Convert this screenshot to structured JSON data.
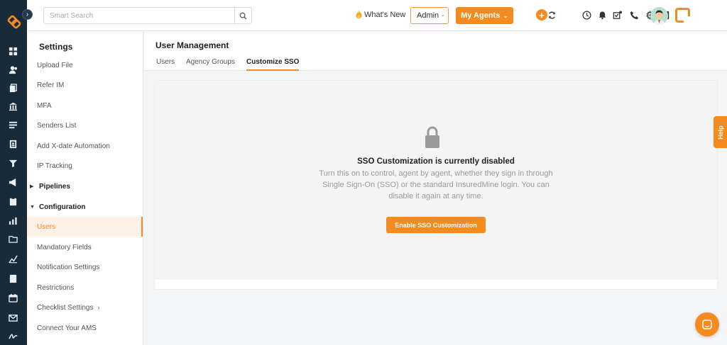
{
  "search": {
    "placeholder": "Smart Search"
  },
  "topbar": {
    "whats_new": "What's New",
    "role": "Admin",
    "my_agents": "My Agents",
    "plus": "+"
  },
  "settings": {
    "title": "Settings",
    "items": [
      {
        "label": "Upload File"
      },
      {
        "label": "Refer IM"
      },
      {
        "label": "MFA"
      },
      {
        "label": "Senders List"
      },
      {
        "label": "Add X-date Automation"
      },
      {
        "label": "IP Tracking"
      },
      {
        "label": "Pipelines"
      },
      {
        "label": "Configuration"
      },
      {
        "label": "Users"
      },
      {
        "label": "Mandatory Fields"
      },
      {
        "label": "Notification Settings"
      },
      {
        "label": "Restrictions"
      },
      {
        "label": "Checklist Settings"
      },
      {
        "label": "Connect Your AMS"
      }
    ]
  },
  "main": {
    "title": "User Management",
    "tabs": [
      {
        "label": "Users"
      },
      {
        "label": "Agency Groups"
      },
      {
        "label": "Customize SSO"
      }
    ],
    "active_tab": "Customize SSO"
  },
  "sso": {
    "title": "SSO Customization is currently disabled",
    "description": "Turn this on to control, agent by agent, whether they sign in through Single Sign-On (SSO) or the standard InsuredMine login. You can disable it again at any time.",
    "button": "Enable SSO Customization"
  },
  "help": {
    "label": "Help"
  },
  "colors": {
    "accent": "#f58a1f",
    "rail": "#172b3a"
  }
}
